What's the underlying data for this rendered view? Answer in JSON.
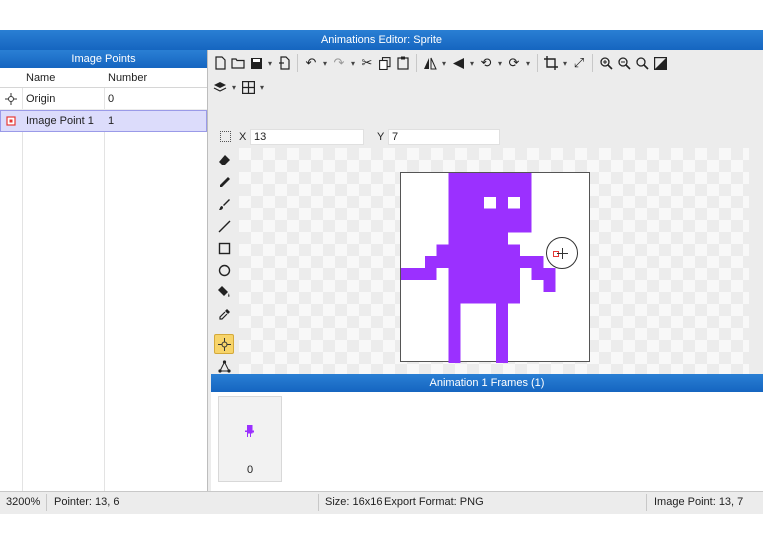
{
  "window": {
    "title": "Animations Editor: Sprite"
  },
  "left_panel": {
    "header": "Image Points",
    "columns": [
      "Name",
      "Number"
    ],
    "rows": [
      {
        "icon": "origin-crosshair-icon",
        "name": "Origin",
        "number": "0"
      },
      {
        "icon": "image-point-icon",
        "name": "Image Point 1",
        "number": "1"
      }
    ]
  },
  "coords": {
    "x_label": "X",
    "x_value": "13",
    "y_label": "Y",
    "y_value": "7"
  },
  "frames_panel": {
    "header": "Animation 1 Frames (1)",
    "frames": [
      {
        "label": "0"
      }
    ]
  },
  "status": {
    "zoom": "3200%",
    "pointer": "Pointer: 13, 6",
    "size": "Size: 16x16",
    "export": "Export Format: PNG",
    "image_point": "Image Point: 13, 7"
  },
  "colors": {
    "accent": "#1565c0",
    "sprite": "#9b30ff",
    "selected_row": "#dcdcfb",
    "active_tool": "#f7d46a"
  },
  "toolbar": {
    "row1": [
      "new-file-icon",
      "open-folder-icon",
      "save-icon",
      "import-icon",
      "undo-icon",
      "redo-icon",
      "cut-icon",
      "copy-icon",
      "paste-icon",
      "flip-icon",
      "mirror-icon",
      "rotate-left-icon",
      "rotate-right-icon",
      "crop-icon",
      "resize-icon",
      "zoom-in-icon",
      "zoom-out-icon",
      "zoom-reset-icon",
      "toggle-background-icon"
    ],
    "row2": [
      "layers-icon",
      "grid-icon"
    ]
  },
  "tools": [
    "eraser-icon",
    "pencil-icon",
    "brush-icon",
    "line-icon",
    "rectangle-icon",
    "ellipse-icon",
    "fill-bucket-icon",
    "color-picker-icon",
    "image-point-tool-icon",
    "transform-points-icon"
  ]
}
